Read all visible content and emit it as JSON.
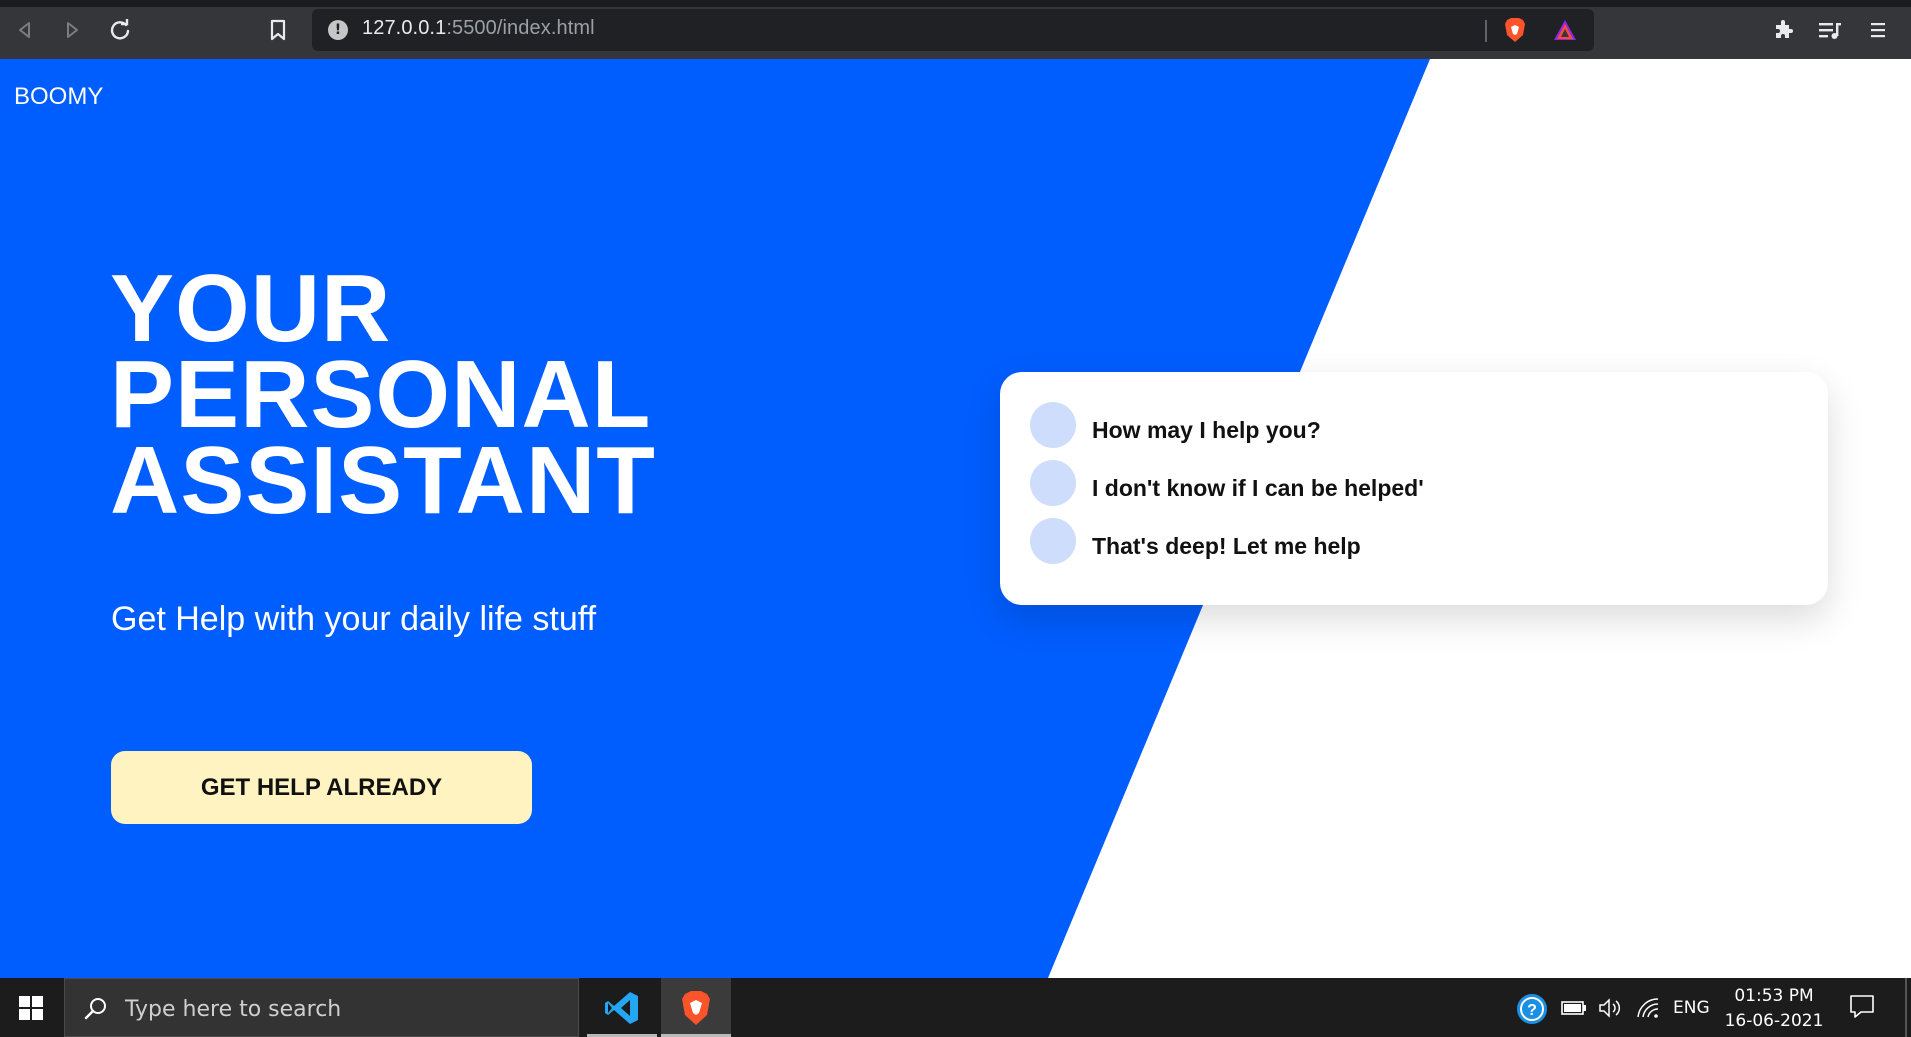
{
  "browser": {
    "url_host": "127.0.0.1",
    "url_path": ":5500/index.html"
  },
  "page": {
    "brand": "BOOMY",
    "hero_lines": [
      "YOUR",
      "PERSONAL",
      "ASSISTANT"
    ],
    "subtitle": "Get Help with your daily life stuff",
    "cta_label": "GET HELP ALREADY",
    "chat_messages": [
      "How may I help you?",
      "I don't know if I can be helped'",
      "That's deep! Let me help"
    ],
    "colors": {
      "primary_blue": "#005dfe",
      "cta_background": "#fff3c1",
      "avatar": "#cdddfb"
    }
  },
  "taskbar": {
    "search_placeholder": "Type here to search",
    "language": "ENG",
    "time": "01:53 PM",
    "date": "16-06-2021",
    "apps": [
      "vscode-icon",
      "brave-icon"
    ]
  }
}
